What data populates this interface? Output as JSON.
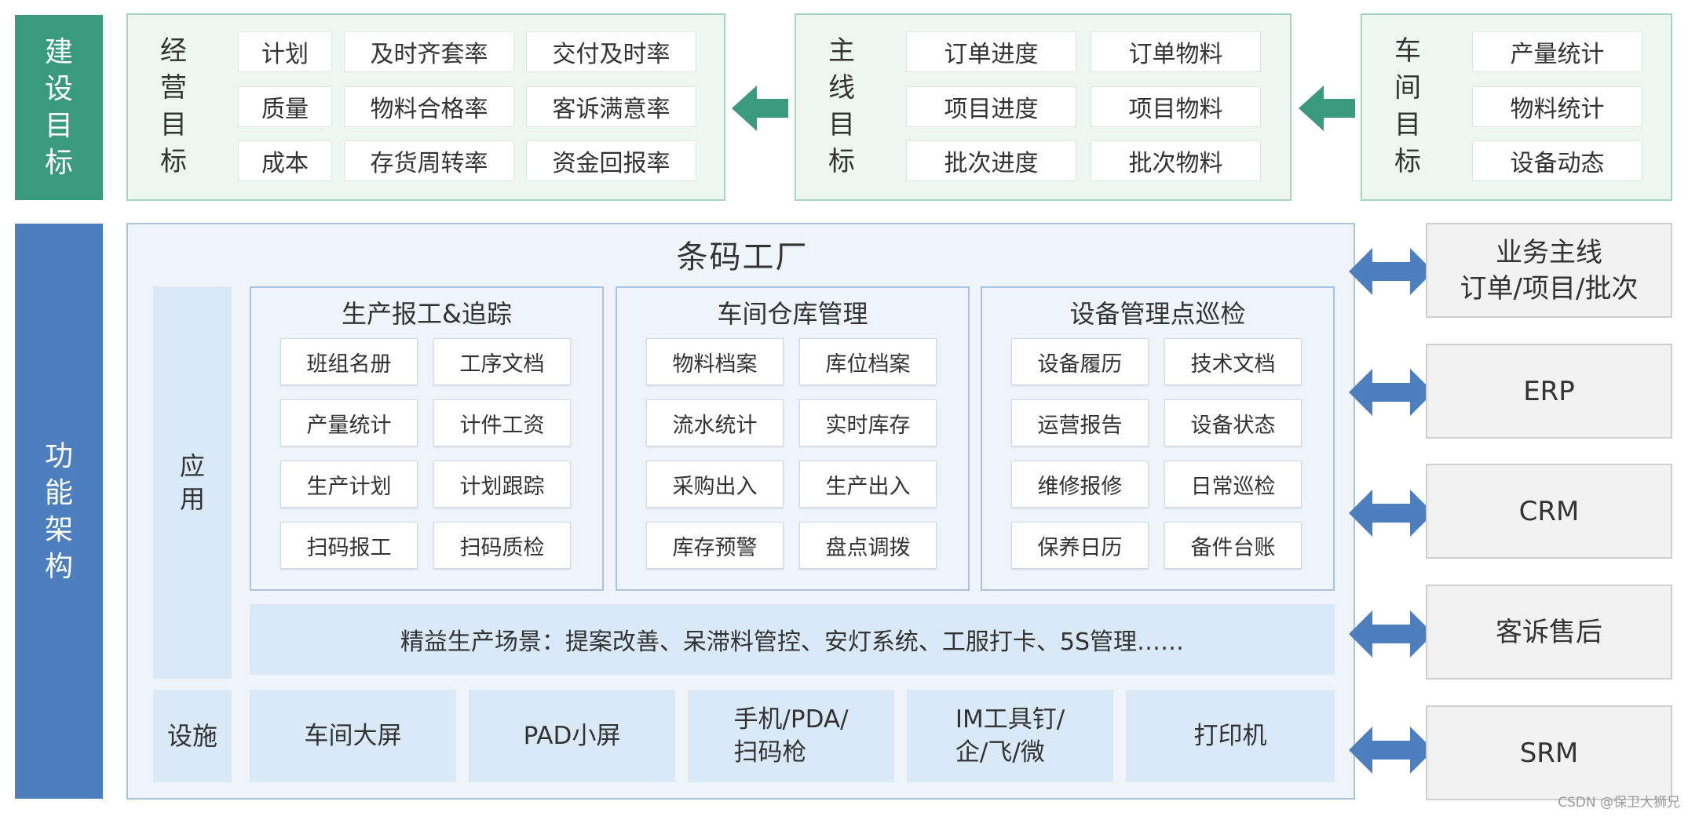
{
  "left_labels": {
    "goals": "建设目标",
    "architecture": "功能架构"
  },
  "business_goals": {
    "label": "经营目标",
    "cells": [
      "计划",
      "及时齐套率",
      "交付及时率",
      "质量",
      "物料合格率",
      "客诉满意率",
      "成本",
      "存货周转率",
      "资金回报率"
    ]
  },
  "mainline_goals": {
    "label": "主线目标",
    "cells": [
      "订单进度",
      "订单物料",
      "项目进度",
      "项目物料",
      "批次进度",
      "批次物料"
    ]
  },
  "workshop_goals": {
    "label": "车间目标",
    "cells": [
      "产量统计",
      "物料统计",
      "设备动态"
    ]
  },
  "factory": {
    "title": "条码工厂",
    "app_label": "应用",
    "facility_label": "设施",
    "groups": [
      {
        "title": "生产报工&追踪",
        "items": [
          "班组名册",
          "工序文档",
          "产量统计",
          "计件工资",
          "生产计划",
          "计划跟踪",
          "扫码报工",
          "扫码质检"
        ]
      },
      {
        "title": "车间仓库管理",
        "items": [
          "物料档案",
          "库位档案",
          "流水统计",
          "实时库存",
          "采购出入",
          "生产出入",
          "库存预警",
          "盘点调拨"
        ]
      },
      {
        "title": "设备管理点巡检",
        "items": [
          "设备履历",
          "技术文档",
          "运营报告",
          "设备状态",
          "维修报修",
          "日常巡检",
          "保养日历",
          "备件台账"
        ]
      }
    ],
    "lean": "精益生产场景：提案改善、呆滞料管控、安灯系统、工服打卡、5S管理……",
    "facilities": [
      {
        "line1": "车间大屏",
        "line2": ""
      },
      {
        "line1": "PAD小屏",
        "line2": ""
      },
      {
        "line1": "手机/PDA/",
        "line2": "扫码枪"
      },
      {
        "line1": "IM工具钉/",
        "line2": "企/飞/微"
      },
      {
        "line1": "打印机",
        "line2": ""
      }
    ]
  },
  "systems": [
    {
      "line1": "业务主线",
      "line2": "订单/项目/批次"
    },
    {
      "line1": "ERP",
      "line2": ""
    },
    {
      "line1": "CRM",
      "line2": ""
    },
    {
      "line1": "客诉售后",
      "line2": ""
    },
    {
      "line1": "SRM",
      "line2": ""
    }
  ],
  "watermark": "CSDN @保卫大狮兄",
  "colors": {
    "goal_green": "#3a9a7e",
    "arch_blue": "#4d7fbe",
    "double_arrow": "#4d7fbe"
  },
  "icons": {
    "goal_flow": "arrow-left-icon",
    "integration": "double-arrow-icon"
  }
}
